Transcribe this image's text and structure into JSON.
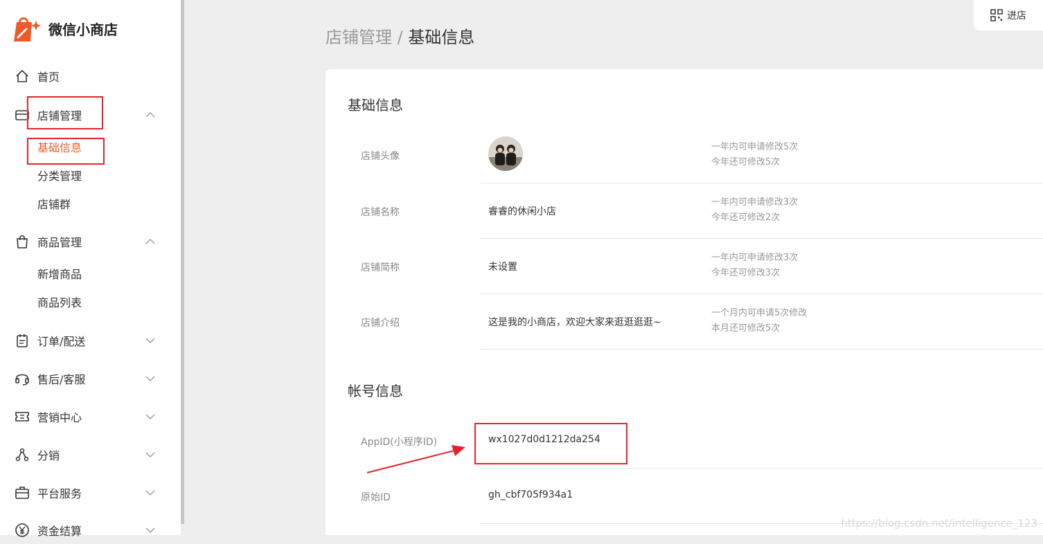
{
  "app": {
    "name": "微信小商店"
  },
  "topbar": {
    "enter_shop_label": "进店"
  },
  "breadcrumb": {
    "parent": "店铺管理",
    "separator": " / ",
    "current": "基础信息"
  },
  "sidebar": {
    "home": "首页",
    "shop_mgmt": "店铺管理",
    "shop_sub": [
      "基础信息",
      "分类管理",
      "店铺群"
    ],
    "goods_mgmt": "商品管理",
    "goods_sub": [
      "新增商品",
      "商品列表"
    ],
    "orders": "订单/配送",
    "after_sales": "售后/客服",
    "marketing": "营销中心",
    "distribution": "分销",
    "platform": "平台服务",
    "settlement": "资金结算"
  },
  "basic_info": {
    "title": "基础信息",
    "avatar": {
      "label": "店铺头像",
      "note1": "一年内可申请修改5次",
      "note2": "今年还可修改5次"
    },
    "name": {
      "label": "店铺名称",
      "value": "睿睿的休闲小店",
      "note1": "一年内可申请修改3次",
      "note2": "今年还可修改2次"
    },
    "short_name": {
      "label": "店铺简称",
      "value": "未设置",
      "note1": "一年内可申请修改3次",
      "note2": "今年还可修改3次"
    },
    "intro": {
      "label": "店铺介绍",
      "value": "这是我的小商店，欢迎大家来逛逛逛逛~",
      "note1": "一个月内可申请5次修改",
      "note2": "本月还可修改5次"
    }
  },
  "account_info": {
    "title": "帐号信息",
    "appid": {
      "label": "AppID(小程序ID)",
      "value": "wx1027d0d1212da254"
    },
    "original_id": {
      "label": "原始ID",
      "value": "gh_cbf705f934a1"
    }
  },
  "watermark": "https://blog.csdn.net/intelligence_123",
  "colors": {
    "accent": "#f05a28",
    "annotation_red": "#e8212b"
  }
}
